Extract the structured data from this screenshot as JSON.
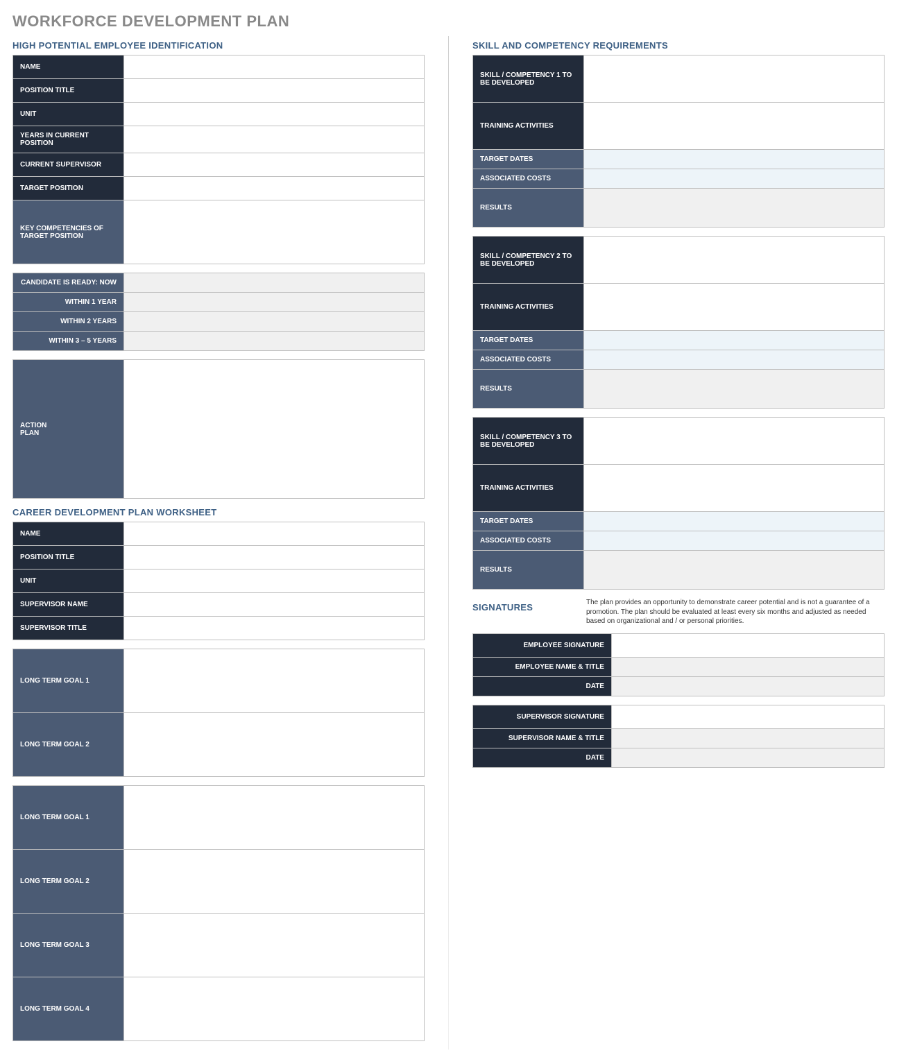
{
  "title": "WORKFORCE DEVELOPMENT PLAN",
  "hp": {
    "heading": "HIGH POTENTIAL EMPLOYEE IDENTIFICATION",
    "name": "NAME",
    "position": "POSITION TITLE",
    "unit": "UNIT",
    "years": "YEARS IN CURRENT POSITION",
    "supervisor": "CURRENT SUPERVISOR",
    "target": "TARGET POSITION",
    "keycomp": "KEY COMPETENCIES OF TARGET POSITION",
    "ready_now": "CANDIDATE IS READY:  NOW",
    "ready_1": "WITHIN 1 YEAR",
    "ready_2": "WITHIN 2 YEARS",
    "ready_35": "WITHIN 3 – 5 YEARS",
    "action": "ACTION\nPLAN"
  },
  "cdp": {
    "heading": "CAREER DEVELOPMENT PLAN WORKSHEET",
    "name": "NAME",
    "position": "POSITION TITLE",
    "unit": "UNIT",
    "supname": "SUPERVISOR NAME",
    "suptitle": "SUPERVISOR TITLE",
    "lt1": "LONG TERM GOAL 1",
    "lt2": "LONG TERM GOAL 2",
    "lt1b": "LONG TERM GOAL 1",
    "lt2b": "LONG TERM GOAL 2",
    "lt3": "LONG TERM GOAL 3",
    "lt4": "LONG TERM GOAL 4"
  },
  "scr": {
    "heading": "SKILL AND COMPETENCY REQUIREMENTS",
    "s1": "SKILL / COMPETENCY 1 TO BE DEVELOPED",
    "s2": "SKILL / COMPETENCY 2 TO BE DEVELOPED",
    "s3": "SKILL / COMPETENCY 3 TO BE DEVELOPED",
    "training": "TRAINING ACTIVITIES",
    "dates": "TARGET DATES",
    "costs": "ASSOCIATED COSTS",
    "results": "RESULTS"
  },
  "sig": {
    "heading": "SIGNATURES",
    "note": "The plan provides an opportunity to demonstrate career potential and is not a guarantee of a promotion. The plan should be evaluated at least every six months and adjusted as needed based on organizational and / or personal priorities.",
    "empsig": "EMPLOYEE SIGNATURE",
    "empname": "EMPLOYEE NAME & TITLE",
    "date": "DATE",
    "supsig": "SUPERVISOR SIGNATURE",
    "supname": "SUPERVISOR NAME & TITLE"
  }
}
